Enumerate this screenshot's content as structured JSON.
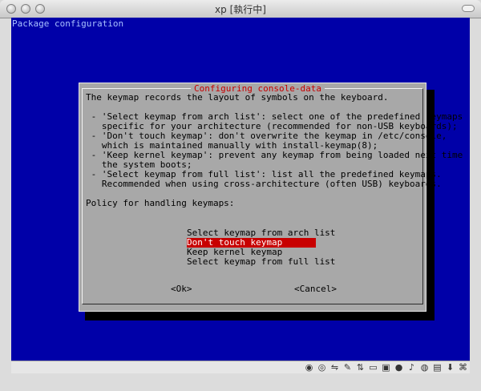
{
  "window": {
    "title": "xp [執行中]"
  },
  "terminal": {
    "header": "Package configuration"
  },
  "dialog": {
    "title": "Configuring console-data",
    "text": "The keymap records the layout of symbols on the keyboard.\n\n - 'Select keymap from arch list': select one of the predefined keymaps\n   specific for your architecture (recommended for non-USB keyboards);\n - 'Don't touch keymap': don't overwrite the keymap in /etc/console,\n   which is maintained manually with install-keymap(8);\n - 'Keep kernel keymap': prevent any keymap from being loaded next time\n   the system boots;\n - 'Select keymap from full list': list all the predefined keymaps.\n   Recommended when using cross-architecture (often USB) keyboards.\n\nPolicy for handling keymaps:",
    "options": [
      "Select keymap from arch list",
      "Don't touch keymap",
      "Keep kernel keymap",
      "Select keymap from full list"
    ],
    "selected_index": 1,
    "ok_label": "<Ok>",
    "cancel_label": "<Cancel>"
  },
  "statusbar": {
    "host_key": "⌘",
    "icons": [
      "disk-icon",
      "cdrom-icon",
      "usb-icon",
      "edit-icon",
      "network-icon",
      "folder-icon",
      "display-icon",
      "record-icon",
      "audio-icon",
      "mouse-icon",
      "keyboard-icon",
      "arrow-down-icon"
    ]
  },
  "colors": {
    "screen_bg": "#0000a8",
    "dialog_bg": "#a8a8a8",
    "title_fg": "#c80000",
    "selection_bg": "#c80000"
  }
}
